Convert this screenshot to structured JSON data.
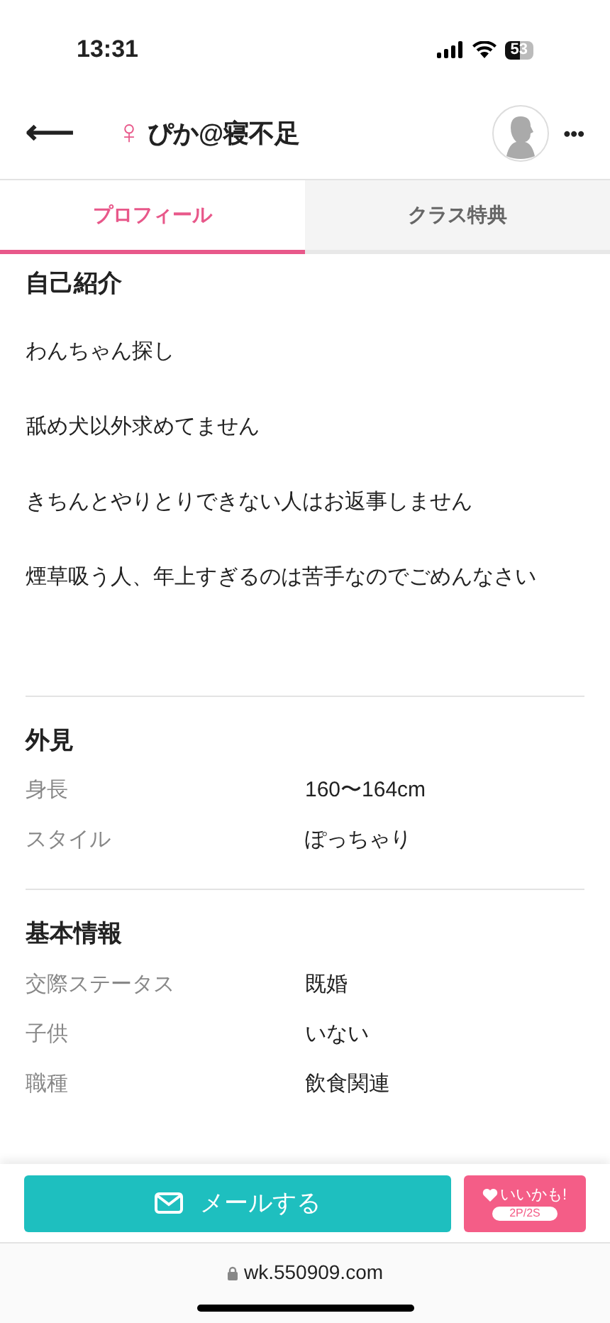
{
  "status_bar": {
    "time": "13:31",
    "battery": "53"
  },
  "header": {
    "back": "⟵",
    "gender": "♀",
    "name": "ぴか@寝不足",
    "more": "•••"
  },
  "tabs": [
    {
      "label": "プロフィール",
      "selected": true
    },
    {
      "label": "クラス特典",
      "selected": false
    }
  ],
  "intro": {
    "title": "自己紹介",
    "paragraphs": [
      "わんちゃん探し",
      "舐め犬以外求めてません",
      "きちんとやりとりできない人はお返事しません",
      "煙草吸う人、年上すぎるのは苦手なのでごめんなさい"
    ]
  },
  "sections": [
    {
      "title": "外見",
      "rows": [
        {
          "label": "身長",
          "value": "160〜164cm"
        },
        {
          "label": "スタイル",
          "value": "ぽっちゃり"
        }
      ]
    },
    {
      "title": "基本情報",
      "rows": [
        {
          "label": "交際ステータス",
          "value": "既婚"
        },
        {
          "label": "子供",
          "value": "いない"
        },
        {
          "label": "職種",
          "value": "飲食関連"
        }
      ]
    }
  ],
  "actions": {
    "mail": "メールする",
    "like": "いいかも!",
    "like_cost": "2P/2S"
  },
  "url_bar": {
    "url": "wk.550909.com"
  }
}
